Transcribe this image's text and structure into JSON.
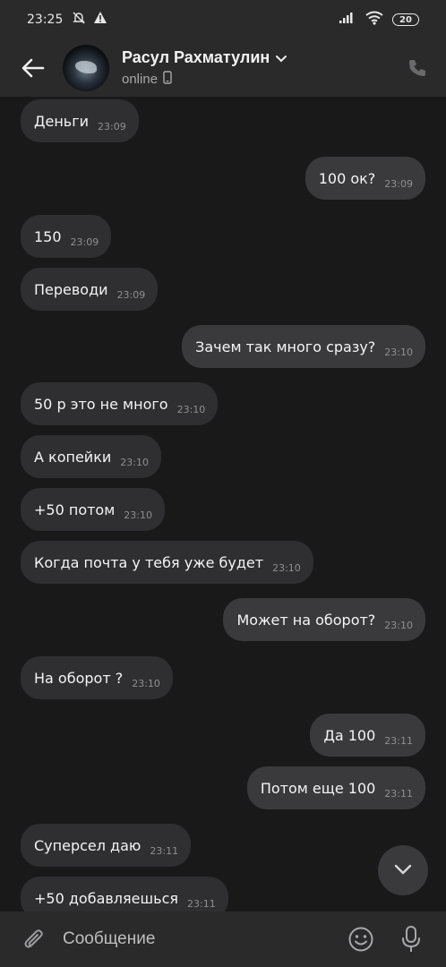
{
  "status_bar": {
    "time": "23:25",
    "battery": "20",
    "icons": [
      "dnd-off-icon",
      "warning-icon",
      "signal-icon",
      "wifi-icon",
      "battery-icon"
    ]
  },
  "header": {
    "contact_name": "Расул Рахматулин",
    "status": "online",
    "icons": [
      "back-arrow-icon",
      "avatar",
      "chevron-down-icon",
      "mobile-device-icon",
      "phone-icon"
    ]
  },
  "messages": [
    {
      "dir": "in",
      "text": "Деньги",
      "time": "23:09"
    },
    {
      "dir": "out",
      "text": "100 ок?",
      "time": "23:09"
    },
    {
      "dir": "in",
      "text": "150",
      "time": "23:09"
    },
    {
      "dir": "in",
      "text": "Переводи",
      "time": "23:09"
    },
    {
      "dir": "out",
      "text": "Зачем так много сразу?",
      "time": "23:10"
    },
    {
      "dir": "in",
      "text": "50 р это не много",
      "time": "23:10"
    },
    {
      "dir": "in",
      "text": "А копейки",
      "time": "23:10"
    },
    {
      "dir": "in",
      "text": "+50 потом",
      "time": "23:10"
    },
    {
      "dir": "in",
      "text": "Когда почта у тебя уже будет",
      "time": "23:10"
    },
    {
      "dir": "out",
      "text": "Может на оборот?",
      "time": "23:10"
    },
    {
      "dir": "in",
      "text": "На оборот ?",
      "time": "23:10"
    },
    {
      "dir": "out",
      "text": "Да 100",
      "time": "23:11"
    },
    {
      "dir": "out",
      "text": "Потом еще 100",
      "time": "23:11"
    },
    {
      "dir": "in",
      "text": "Суперсел даю",
      "time": "23:11"
    },
    {
      "dir": "in",
      "text": "+50 добавляешься",
      "time": "23:11"
    }
  ],
  "composer": {
    "placeholder": "Сообщение",
    "icons": [
      "paperclip-icon",
      "emoji-icon",
      "microphone-icon"
    ]
  },
  "colors": {
    "background": "#19191a",
    "bar": "#2a2a2b",
    "incoming_bubble": "#2f2f31",
    "outgoing_bubble": "#3a3a3c",
    "timestamp": "#8f8f93"
  }
}
